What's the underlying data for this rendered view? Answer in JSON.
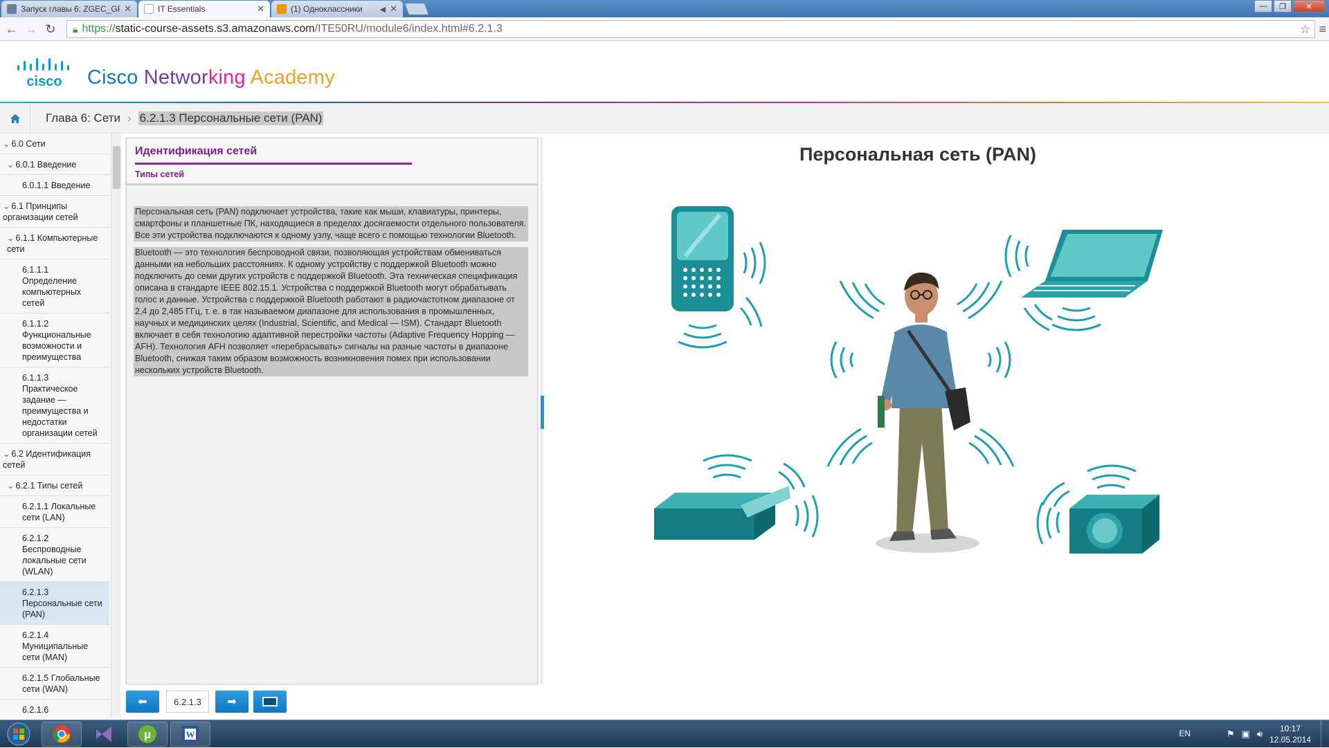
{
  "browser": {
    "tabs": [
      {
        "title": "Запуск главы 6: ZGEC_GR",
        "fav_color": "#6c7f99"
      },
      {
        "title": "IT Essentials",
        "fav_color": "#9aa3ad"
      },
      {
        "title": "(1) Одноклассники",
        "fav_color": "#f29400"
      }
    ],
    "url_scheme": "https://",
    "url_host": "static-course-assets.s3.amazonaws.com",
    "url_path": "/ITE50RU/module6/index.html#6.2.1.3"
  },
  "header": {
    "logo_text": "cisco",
    "brand": [
      "Cisco ",
      "Networ",
      "king ",
      "Academy"
    ]
  },
  "breadcrumb": {
    "chapter": "Глава 6: Сети",
    "page": "6.2.1.3 Персональные сети (PAN)"
  },
  "sidebar": {
    "items": [
      {
        "label": "6.0 Сети",
        "level": 0,
        "chevron": true
      },
      {
        "label": "6.0.1 Введение",
        "level": 1,
        "chevron": true
      },
      {
        "label": "6.0.1.1 Введение",
        "level": 2
      },
      {
        "label": "6.1 Принципы организации сетей",
        "level": 0,
        "chevron": true
      },
      {
        "label": "6.1.1 Компьютерные сети",
        "level": 1,
        "chevron": true
      },
      {
        "label": "6.1.1.1 Определение компьютерных сетей",
        "level": 2
      },
      {
        "label": "6.1.1.2 Функциональные возможности и преимущества",
        "level": 2
      },
      {
        "label": "6.1.1.3 Практическое задание — преимущества и недостатки организации сетей",
        "level": 2
      },
      {
        "label": "6.2 Идентификация сетей",
        "level": 0,
        "chevron": true
      },
      {
        "label": "6.2.1 Типы сетей",
        "level": 1,
        "chevron": true
      },
      {
        "label": "6.2.1.1 Локальные сети (LAN)",
        "level": 2
      },
      {
        "label": "6.2.1.2 Беспроводные локальные сети (WLAN)",
        "level": 2
      },
      {
        "label": "6.2.1.3 Персональные сети (PAN)",
        "level": 2,
        "active": true
      },
      {
        "label": "6.2.1.4 Муниципальные сети (MAN)",
        "level": 2
      },
      {
        "label": "6.2.1.5 Глобальные сети (WAN)",
        "level": 2
      },
      {
        "label": "6.2.1.6",
        "level": 2
      }
    ]
  },
  "panel": {
    "title": "Идентификация сетей",
    "subtitle": "Типы сетей",
    "paragraphs": [
      "Персональная сеть (PAN) подключает устройства, такие как мыши, клавиатуры, принтеры, смартфоны и планшетные ПК, находящиеся в пределах досягаемости отдельного пользователя. Все эти устройства подключаются к одному узлу, чаще всего с помощью технологии Bluetooth.",
      "Bluetooth — это технология беспроводной связи, позволяющая устройствам обмениваться данными на небольших расстояниях. К одному устройству с поддержкой Bluetooth можно подключить до семи других устройств с поддержкой Bluetooth. Эта техническая спецификация описана в стандарте IEEE 802.15.1. Устройства с поддержкой Bluetooth могут обрабатывать голос и данные. Устройства с поддержкой Bluetooth работают в радиочастотном диапазоне от 2,4 до 2,485 ГГц, т. е. в так называемом диапазоне для использования в промышленных, научных и медицинских целях (Industrial, Scientific, and Medical — ISM). Стандарт Bluetooth включает в себя технологию адаптивной перестройки частоты (Adaptive Frequency Hopping — AFH). Технология AFH позволяет «перебрасывать» сигналы на разные частоты в диапазоне Bluetooth, снижая таким образом возможность возникновения помех при использовании нескольких устройств Bluetooth."
    ]
  },
  "pager": {
    "current": "6.2.1.3"
  },
  "illustration": {
    "title": "Персональная сеть (PAN)",
    "accent": "#1aa0b0"
  },
  "taskbar": {
    "lang": "EN",
    "time": "10:17",
    "date": "12.05.2014"
  }
}
